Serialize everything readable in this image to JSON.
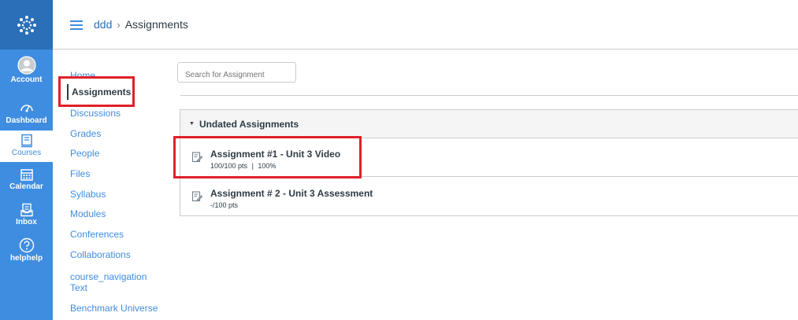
{
  "global_nav": {
    "items": [
      {
        "label": "Account",
        "icon": "account-icon"
      },
      {
        "label": "Dashboard",
        "icon": "dashboard-icon"
      },
      {
        "label": "Courses",
        "icon": "courses-icon",
        "active": true
      },
      {
        "label": "Calendar",
        "icon": "calendar-icon"
      },
      {
        "label": "Inbox",
        "icon": "inbox-icon"
      },
      {
        "label": "helphelp",
        "icon": "help-icon"
      }
    ],
    "colors": {
      "nav_bg": "#3f8de0",
      "logo_bg": "#2a6fb8"
    }
  },
  "breadcrumb": {
    "course": "ddd",
    "separator": "›",
    "current": "Assignments"
  },
  "course_nav": {
    "items": [
      {
        "label": "Home"
      },
      {
        "label": "Assignments",
        "active": true
      },
      {
        "label": "Discussions"
      },
      {
        "label": "Grades"
      },
      {
        "label": "People"
      },
      {
        "label": "Files"
      },
      {
        "label": "Syllabus"
      },
      {
        "label": "Modules"
      },
      {
        "label": "Conferences"
      },
      {
        "label": "Collaborations"
      },
      {
        "label": "course_navigation Text"
      },
      {
        "label": "Benchmark Universe"
      }
    ]
  },
  "search": {
    "placeholder": "Search for Assignment",
    "value": ""
  },
  "assignment_group": {
    "title": "Undated Assignments",
    "assignments": [
      {
        "title": "Assignment #1 - Unit 3 Video",
        "score": "100/100 pts",
        "separator": "|",
        "percent": "100%"
      },
      {
        "title": "Assignment # 2 - Unit 3 Assessment",
        "score": "-/100 pts"
      }
    ]
  },
  "highlight_color": "#e0202a"
}
